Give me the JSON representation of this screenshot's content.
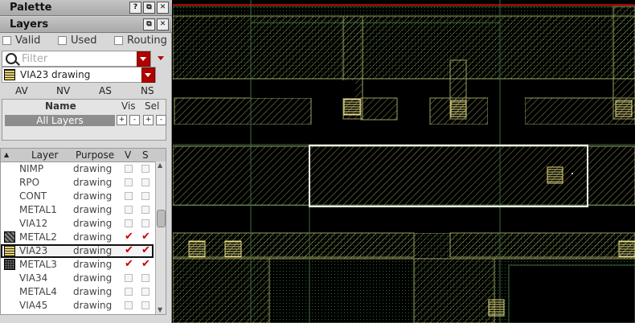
{
  "palette": {
    "title": "Palette",
    "buttons": [
      "?",
      "⧉",
      "✕"
    ]
  },
  "layers_panel": {
    "title": "Layers",
    "buttons": [
      "⧉",
      "✕"
    ],
    "filters": [
      {
        "label": "Valid",
        "checked": false
      },
      {
        "label": "Used",
        "checked": false
      },
      {
        "label": "Routing",
        "checked": false
      }
    ],
    "filter_placeholder": "Filter",
    "current_layer": "VIA23 drawing",
    "modes": [
      "AV",
      "NV",
      "AS",
      "NS"
    ],
    "visibility_header": {
      "name": "Name",
      "vis": "Vis",
      "sel": "Sel"
    },
    "all_layers": "All Layers",
    "pm_buttons": [
      "+",
      "-",
      "+",
      "-"
    ]
  },
  "layer_table": {
    "columns": [
      "Layer",
      "Purpose",
      "V",
      "S"
    ],
    "rows": [
      {
        "layer": "NIMP",
        "purpose": "drawing",
        "v": false,
        "s": false,
        "swatch": "none"
      },
      {
        "layer": "RPO",
        "purpose": "drawing",
        "v": false,
        "s": false,
        "swatch": "none"
      },
      {
        "layer": "CONT",
        "purpose": "drawing",
        "v": false,
        "s": false,
        "swatch": "none"
      },
      {
        "layer": "METAL1",
        "purpose": "drawing",
        "v": false,
        "s": false,
        "swatch": "none"
      },
      {
        "layer": "VIA12",
        "purpose": "drawing",
        "v": false,
        "s": false,
        "swatch": "none"
      },
      {
        "layer": "METAL2",
        "purpose": "drawing",
        "v": true,
        "s": true,
        "swatch": "diag"
      },
      {
        "layer": "VIA23",
        "purpose": "drawing",
        "v": true,
        "s": true,
        "swatch": "lines",
        "selected": true
      },
      {
        "layer": "METAL3",
        "purpose": "drawing",
        "v": true,
        "s": true,
        "swatch": "dots"
      },
      {
        "layer": "VIA34",
        "purpose": "drawing",
        "v": false,
        "s": false,
        "swatch": "none"
      },
      {
        "layer": "METAL4",
        "purpose": "drawing",
        "v": false,
        "s": false,
        "swatch": "none"
      },
      {
        "layer": "VIA45",
        "purpose": "drawing",
        "v": false,
        "s": false,
        "swatch": "none"
      }
    ]
  },
  "colors": {
    "canvas_bg": "#000000",
    "metal_hatch": "#9aa060",
    "via_fill": "#e8e080",
    "selection": "#ffffff",
    "check_red": "#cc0000",
    "accent_red": "#b00000"
  }
}
